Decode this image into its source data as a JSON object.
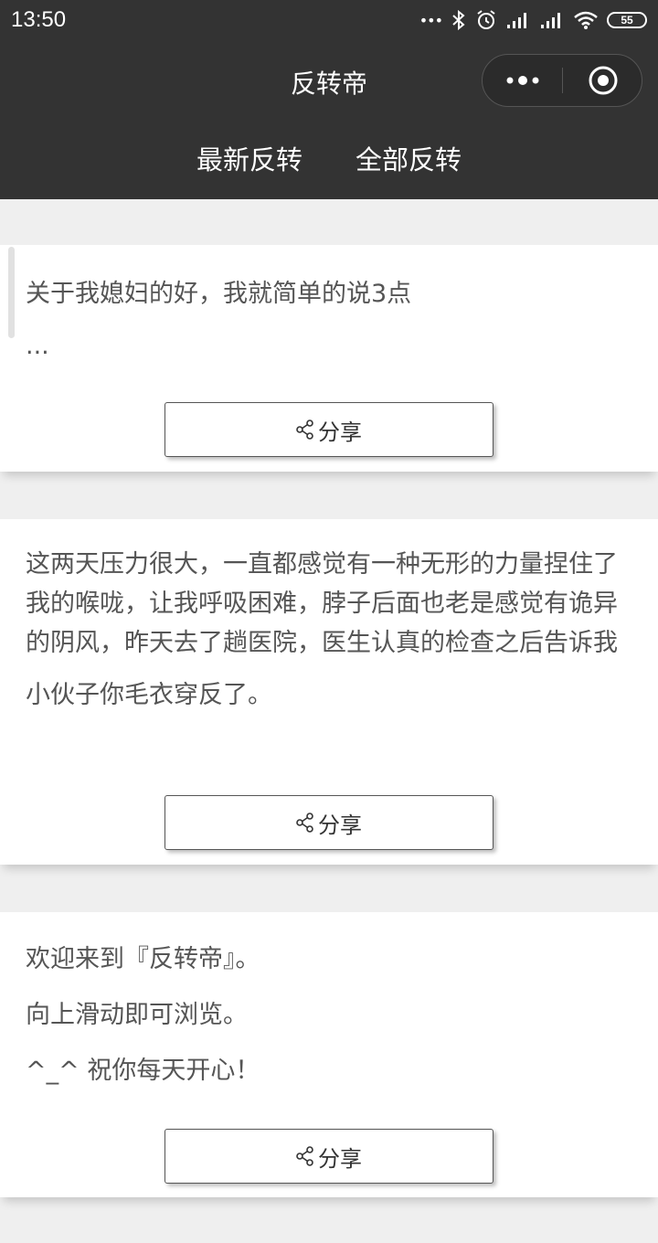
{
  "status_bar": {
    "time": "13:50",
    "dots": "•••",
    "battery": "55"
  },
  "nav": {
    "title": "反转帝"
  },
  "tabs": [
    {
      "label": "最新反转"
    },
    {
      "label": "全部反转"
    }
  ],
  "posts": [
    {
      "paragraphs": [
        "关于我媳妇的好，我就简单的说3点",
        "..."
      ],
      "share_label": "分享"
    },
    {
      "paragraphs": [
        "这两天压力很大，一直都感觉有一种无形的力量捏住了我的喉咙，让我呼吸困难，脖子后面也老是感觉有诡异的阴风，昨天去了趟医院，医生认真的检查之后告诉我",
        "小伙子你毛衣穿反了。"
      ],
      "share_label": "分享"
    },
    {
      "paragraphs": [
        "欢迎来到『反转帝』。",
        "向上滑动即可浏览。",
        "^_^ 祝你每天开心！"
      ],
      "share_label": "分享"
    }
  ]
}
